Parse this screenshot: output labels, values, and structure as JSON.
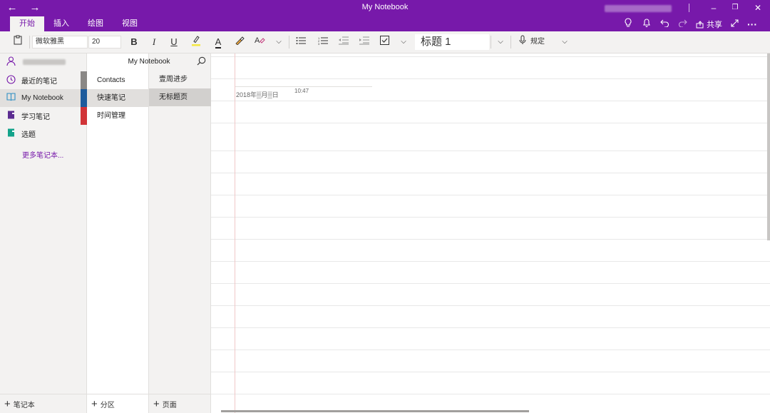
{
  "titlebar": {
    "title": "My Notebook",
    "back_icon": "←",
    "forward_icon": "→",
    "minimize_icon": "–",
    "restore_icon": "❐",
    "close_icon": "✕"
  },
  "ribbon": {
    "tabs": [
      {
        "label": "开始",
        "active": true
      },
      {
        "label": "插入",
        "active": false
      },
      {
        "label": "绘图",
        "active": false
      },
      {
        "label": "视图",
        "active": false
      }
    ],
    "share_label": "共享"
  },
  "toolbar": {
    "font_name": "微软雅黑",
    "font_size": "20",
    "bold": "B",
    "italic": "I",
    "underline": "U",
    "font_color": "A",
    "style": "标题 1",
    "dictate_label": "规定"
  },
  "notebooks": {
    "user_icon": "person-icon",
    "items": [
      {
        "label": "最近的笔记",
        "icon": "clock-icon",
        "color": "#7719aa",
        "tab_color": "#8a8886"
      },
      {
        "label": "My Notebook",
        "icon": "book-icon",
        "color": "#2f8fc4",
        "tab_color": "#1d5b9c",
        "selected": true
      },
      {
        "label": "学习笔记",
        "icon": "notebook-icon",
        "color": "#5c2d91",
        "tab_color": "#d13438"
      },
      {
        "label": "选题",
        "icon": "notebook-icon",
        "color": "#13a38a"
      }
    ],
    "more_label": "更多笔记本...",
    "add_label": "笔记本"
  },
  "sections": {
    "title": "My Notebook",
    "items": [
      {
        "label": "Contacts"
      },
      {
        "label": "快速笔记",
        "selected": true
      },
      {
        "label": "时间管理"
      }
    ],
    "add_label": "分区"
  },
  "pages": {
    "items": [
      {
        "label": "壹周进步"
      },
      {
        "label": "无标题页",
        "selected": true
      }
    ],
    "add_label": "页面"
  },
  "note": {
    "date": "2018年▒月▒日",
    "time": "10:47"
  },
  "colors": {
    "accent": "#7719aa",
    "toolbar_bg": "#f3f2f1"
  }
}
